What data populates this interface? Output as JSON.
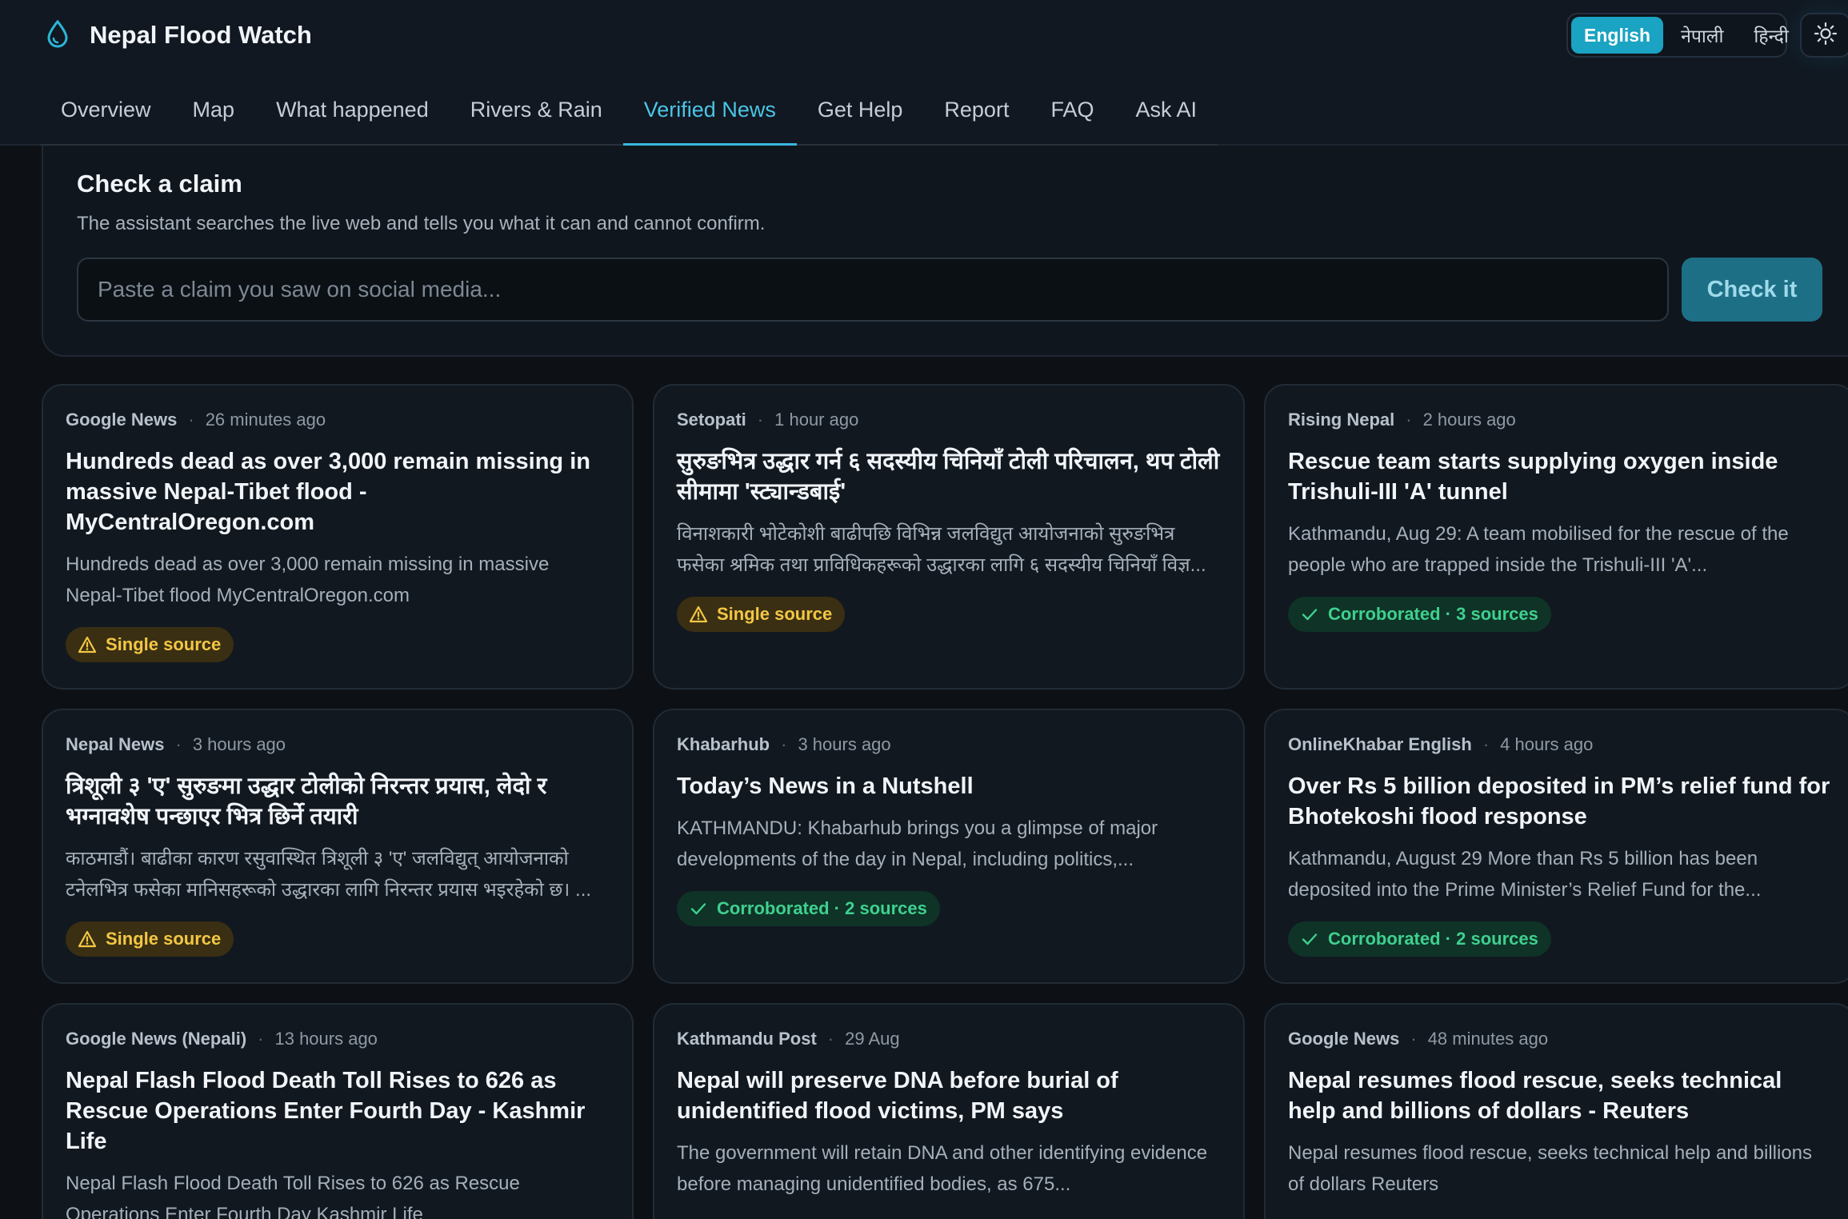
{
  "app": {
    "title": "Nepal Flood Watch",
    "accent": "#1aa3c2"
  },
  "header": {
    "languages": [
      {
        "label": "English",
        "active": true
      },
      {
        "label": "नेपाली",
        "active": false
      },
      {
        "label": "हिन्दी",
        "active": false
      }
    ],
    "theme_icon": "sun-icon"
  },
  "nav": {
    "tabs": [
      {
        "label": "Overview",
        "active": false
      },
      {
        "label": "Map",
        "active": false
      },
      {
        "label": "What happened",
        "active": false
      },
      {
        "label": "Rivers & Rain",
        "active": false
      },
      {
        "label": "Verified News",
        "active": true
      },
      {
        "label": "Get Help",
        "active": false
      },
      {
        "label": "Report",
        "active": false
      },
      {
        "label": "FAQ",
        "active": false
      },
      {
        "label": "Ask AI",
        "active": false
      }
    ]
  },
  "claim": {
    "title": "Check a claim",
    "subtitle": "The assistant searches the live web and tells you what it can and cannot confirm.",
    "placeholder": "Paste a claim you saw on social media...",
    "value": "",
    "button": "Check it"
  },
  "news": [
    {
      "source": "Google News",
      "time": "26 minutes ago",
      "title": "Hundreds dead as over 3,000 remain missing in massive Nepal-Tibet flood - MyCentralOregon.com",
      "desc": "Hundreds dead as over 3,000 remain missing in massive Nepal-Tibet flood MyCentralOregon.com",
      "badge": "Single source",
      "badge_type": "single"
    },
    {
      "source": "Setopati",
      "time": "1 hour ago",
      "title": "सुरुङभित्र उद्धार गर्न ६ सदस्यीय चिनियाँ टोली परिचालन, थप टोली सीमामा 'स्ट्यान्डबाई'",
      "desc": "विनाशकारी भोटेकोशी बाढीपछि विभिन्न जलविद्युत आयोजनाको सुरुङभित्र फसेका श्रमिक तथा प्राविधिकहरूको उद्धारका लागि ६ सदस्यीय चिनियाँ विज्ञ...",
      "badge": "Single source",
      "badge_type": "single"
    },
    {
      "source": "Rising Nepal",
      "time": "2 hours ago",
      "title": "Rescue team starts supplying oxygen inside Trishuli-III 'A' tunnel",
      "desc": "Kathmandu, Aug 29: A team mobilised for the rescue of the people who are trapped inside the Trishuli-III 'A'...",
      "badge": "Corroborated · 3 sources",
      "badge_type": "corr"
    },
    {
      "source": "Nepal News",
      "time": "3 hours ago",
      "title": "त्रिशूली ३ 'ए' सुरुङमा उद्धार टोलीको निरन्तर प्रयास, लेदो र भग्नावशेष पन्छाएर भित्र छिर्ने तयारी",
      "desc": "काठमाडौं। बाढीका कारण रसुवास्थित त्रिशूली ३ 'ए' जलविद्युत् आयोजनाको टनेलभित्र फसेका मानिसहरूको उद्धारका लागि निरन्तर प्रयास भइरहेको छ। ...",
      "badge": "Single source",
      "badge_type": "single"
    },
    {
      "source": "Khabarhub",
      "time": "3 hours ago",
      "title": "Today’s News in a Nutshell",
      "desc": "KATHMANDU: Khabarhub brings you a glimpse of major developments of the day in Nepal, including politics,...",
      "badge": "Corroborated · 2 sources",
      "badge_type": "corr"
    },
    {
      "source": "OnlineKhabar English",
      "time": "4 hours ago",
      "title": "Over Rs 5 billion deposited in PM’s relief fund for Bhotekoshi flood response",
      "desc": "Kathmandu, August 29 More than Rs 5 billion has been deposited into the Prime Minister’s Relief Fund for the...",
      "badge": "Corroborated · 2 sources",
      "badge_type": "corr"
    },
    {
      "source": "Google News (Nepali)",
      "time": "13 hours ago",
      "title": "Nepal Flash Flood Death Toll Rises to 626 as Rescue Operations Enter Fourth Day - Kashmir Life",
      "desc": "Nepal Flash Flood Death Toll Rises to 626 as Rescue Operations Enter Fourth Day Kashmir Life",
      "badge": "",
      "badge_type": ""
    },
    {
      "source": "Kathmandu Post",
      "time": "29 Aug",
      "title": "Nepal will preserve DNA before burial of unidentified flood victims, PM says",
      "desc": "The government will retain DNA and other identifying evidence before managing unidentified bodies, as 675...",
      "badge": "",
      "badge_type": ""
    },
    {
      "source": "Google News",
      "time": "48 minutes ago",
      "title": "Nepal resumes flood rescue, seeks technical help and billions of dollars - Reuters",
      "desc": "Nepal resumes flood rescue, seeks technical help and billions of dollars Reuters",
      "badge": "",
      "badge_type": ""
    }
  ]
}
